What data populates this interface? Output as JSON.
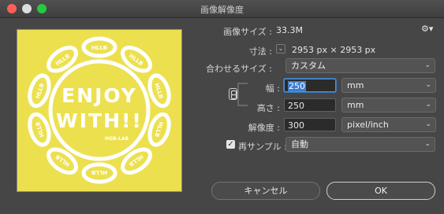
{
  "window": {
    "title": "画像解像度"
  },
  "image_size": {
    "label": "画像サイズ :",
    "value": "33.3M"
  },
  "dimensions": {
    "label": "寸法 :",
    "value": "2953 px × 2953 px"
  },
  "fit_to": {
    "label": "合わせるサイズ :",
    "value": "カスタム"
  },
  "width": {
    "label": "幅 :",
    "value": "250",
    "unit": "mm"
  },
  "height": {
    "label": "高さ :",
    "value": "250",
    "unit": "mm"
  },
  "resolution": {
    "label": "解像度 :",
    "value": "300",
    "unit": "pixel/inch"
  },
  "resample": {
    "label": "再サンプル :",
    "value": "自動",
    "checked": true
  },
  "buttons": {
    "cancel": "キャンセル",
    "ok": "OK"
  },
  "preview": {
    "line1": "ENJOY",
    "line2": "WITH!!",
    "small": "HOB-LAB",
    "ring_text": "HLLB"
  },
  "colors": {
    "preview_bg": "#ece04f",
    "accent": "#4a90d9"
  }
}
